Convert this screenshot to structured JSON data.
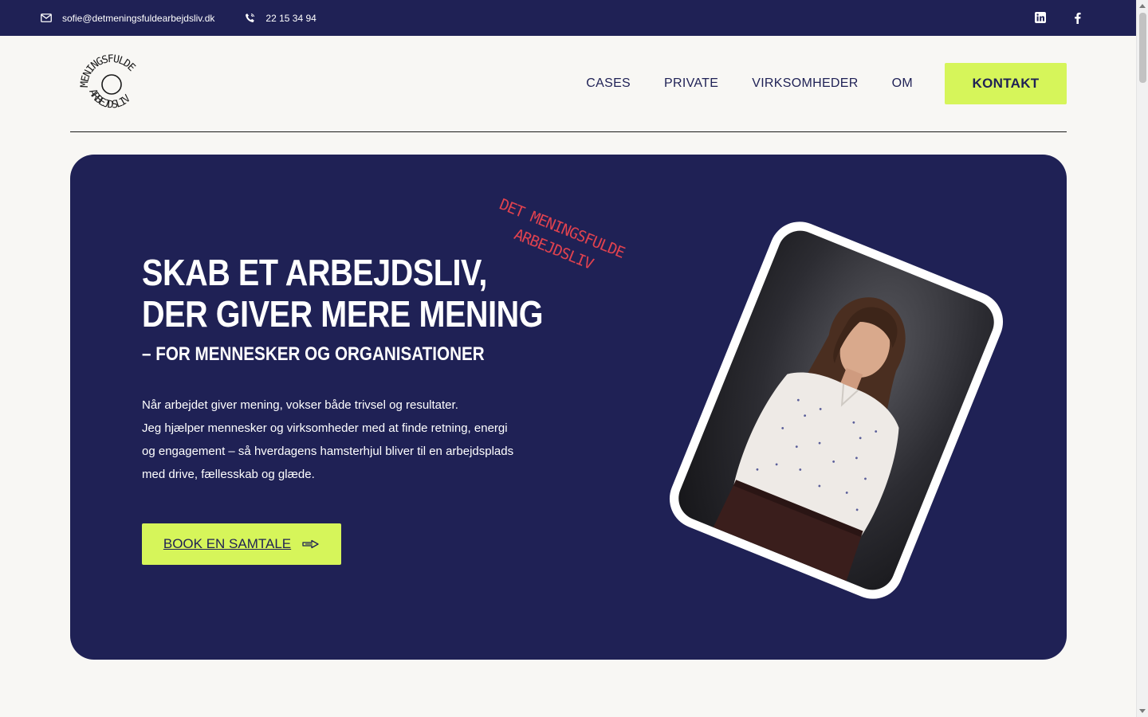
{
  "topbar": {
    "email": "sofie@detmeningsfuldearbejdsliv.dk",
    "phone": "22 15 34 94",
    "social": [
      "linkedin-icon",
      "facebook-icon"
    ]
  },
  "logo": {
    "top_text": "MENINGSFULDE",
    "bottom_text": "ARBEJDSLIV"
  },
  "nav": {
    "items": [
      "CASES",
      "PRIVATE",
      "VIRKSOMHEDER",
      "OM"
    ],
    "cta": "KONTAKT"
  },
  "hero": {
    "title_line1": "SKAB ET ARBEJDSLIV,",
    "title_line2": "DER GIVER MERE MENING",
    "subtitle": "– FOR MENNESKER OG ORGANISATIONER",
    "body": [
      "Når arbejdet giver mening, vokser både trivsel og resultater.",
      "Jeg hjælper mennesker og virksomheder med at finde retning, energi",
      "og engagement – så hverdagens hamsterhjul bliver til en arbejdsplads",
      "med drive, fællesskab og glæde."
    ],
    "button": "BOOK EN SAMTALE",
    "scribble_line1": "DET MENINGSFULDE",
    "scribble_line2": "ARBEJDSLIV"
  },
  "colors": {
    "navy": "#1f2155",
    "lime": "#d6f55a",
    "accent_red": "#e0424f",
    "background": "#f8f7f4"
  }
}
